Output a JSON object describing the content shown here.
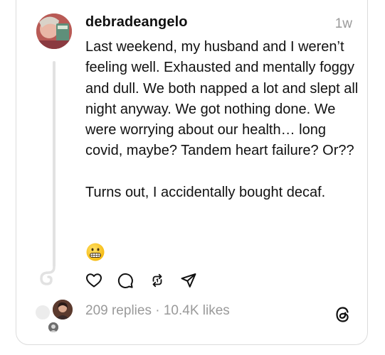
{
  "post": {
    "username": "debradeangelo",
    "timestamp": "1w",
    "body_lines": [
      "Last weekend, my husband and I weren’t feeling well. Exhausted and mentally foggy and dull. We both napped a lot and slept all night anyway. We got nothing done. We were worrying about our health… long covid, maybe? Tandem heart failure? Or??",
      "Turns out, I accidentally bought decaf."
    ],
    "emoji": "grimacing-face"
  },
  "actions": {
    "like_icon": "heart-icon",
    "comment_icon": "comment-icon",
    "repost_icon": "repost-icon",
    "share_icon": "send-icon"
  },
  "stats": {
    "text": "209 replies · 10.4K likes"
  },
  "app": {
    "logo_icon": "threads-logo-icon"
  }
}
